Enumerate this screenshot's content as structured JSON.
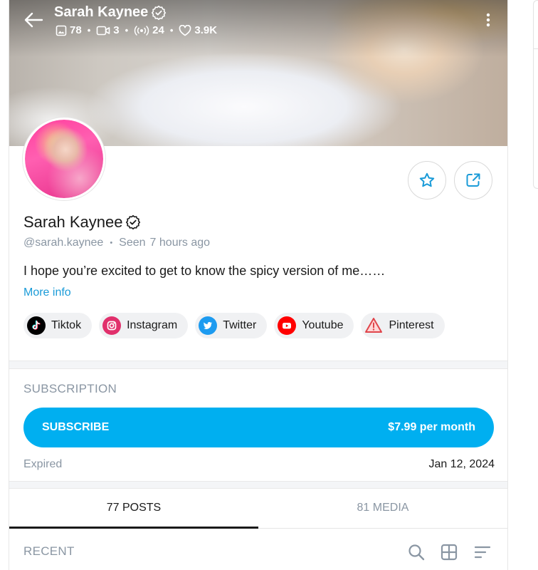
{
  "header": {
    "name": "Sarah Kaynee",
    "stats": {
      "photos": "78",
      "videos": "3",
      "streams": "24",
      "likes": "3.9K"
    }
  },
  "profile": {
    "name": "Sarah Kaynee",
    "handle": "@sarah.kaynee",
    "seen_label": "Seen",
    "seen_time": "7 hours ago",
    "bio": "I hope you’re excited to get to know the spicy version of me……",
    "more_info": "More info"
  },
  "socials": [
    {
      "label": "Tiktok",
      "icon": "tiktok-icon"
    },
    {
      "label": "Instagram",
      "icon": "instagram-icon"
    },
    {
      "label": "Twitter",
      "icon": "twitter-icon"
    },
    {
      "label": "Youtube",
      "icon": "youtube-icon"
    },
    {
      "label": "Pinterest",
      "icon": "warning-icon"
    }
  ],
  "subscription": {
    "title": "SUBSCRIPTION",
    "button_label": "SUBSCRIBE",
    "price": "$7.99 per month",
    "status": "Expired",
    "date": "Jan 12, 2024"
  },
  "tabs": [
    {
      "label": "77 POSTS",
      "active": true
    },
    {
      "label": "81 MEDIA",
      "active": false
    }
  ],
  "feed": {
    "section_title": "RECENT"
  },
  "colors": {
    "accent": "#00aff0",
    "link": "#1a9bd8",
    "muted": "#8a96a3"
  }
}
